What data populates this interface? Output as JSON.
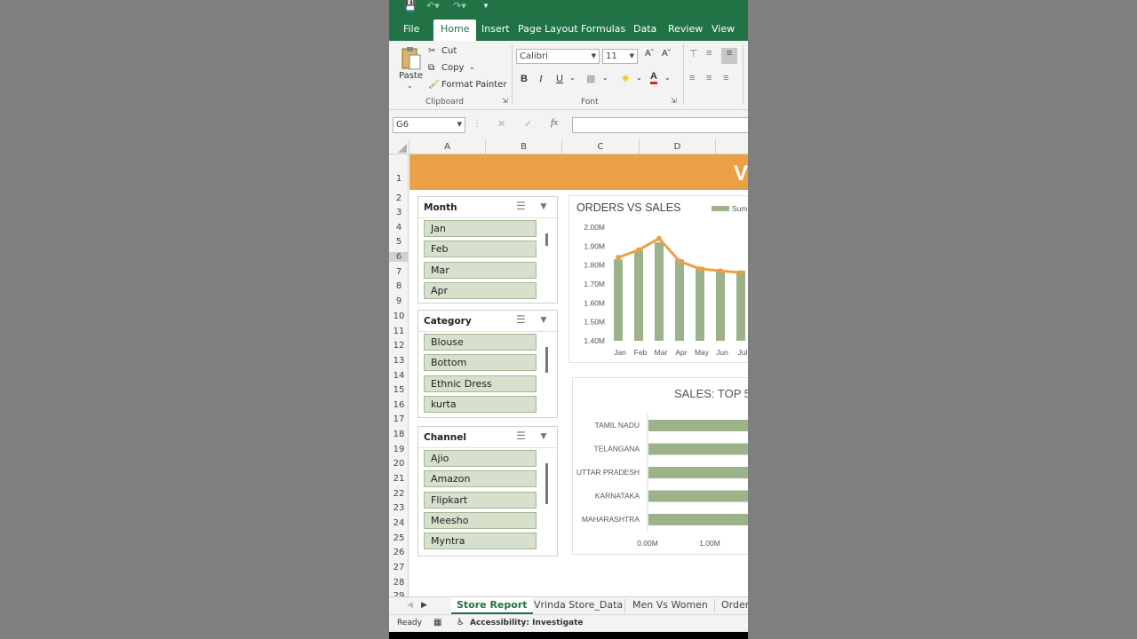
{
  "ribbon_tabs": [
    "File",
    "Home",
    "Insert",
    "Page Layout",
    "Formulas",
    "Data",
    "Review",
    "View"
  ],
  "clipboard": {
    "paste": "Paste",
    "cut": "Cut",
    "copy": "Copy",
    "format_painter": "Format Painter",
    "group": "Clipboard"
  },
  "font": {
    "name": "Calibri",
    "size": "11",
    "group": "Font",
    "bold": "B",
    "italic": "I",
    "underline": "U"
  },
  "formula_bar": {
    "name_box": "G6",
    "fx": "fx",
    "value": ""
  },
  "columns": [
    "A",
    "B",
    "C",
    "D"
  ],
  "rows": [
    "1",
    "2",
    "3",
    "4",
    "5",
    "6",
    "7",
    "8",
    "9",
    "10",
    "11",
    "12",
    "13",
    "14",
    "15",
    "16",
    "17",
    "18",
    "19",
    "20",
    "21",
    "22",
    "23",
    "24",
    "25",
    "26",
    "27",
    "28",
    "29"
  ],
  "banner_text": "V",
  "slicers": {
    "month": {
      "title": "Month",
      "items": [
        "Jan",
        "Feb",
        "Mar",
        "Apr"
      ]
    },
    "category": {
      "title": "Category",
      "items": [
        "Blouse",
        "Bottom",
        "Ethnic Dress",
        "kurta"
      ]
    },
    "channel": {
      "title": "Channel",
      "items": [
        "Ajio",
        "Amazon",
        "Flipkart",
        "Meesho",
        "Myntra"
      ]
    }
  },
  "chart_data": [
    {
      "type": "bar",
      "title": "ORDERS VS SALES",
      "legend": "Sum",
      "legend_position": "top-right",
      "categories": [
        "Jan",
        "Feb",
        "Mar",
        "Apr",
        "May",
        "Jun",
        "Jul"
      ],
      "series": [
        {
          "name": "Sum",
          "type": "bar",
          "values": [
            1.83,
            1.88,
            1.92,
            1.83,
            1.79,
            1.77,
            1.77
          ]
        },
        {
          "type": "line",
          "values": [
            1.84,
            1.88,
            1.94,
            1.82,
            1.78,
            1.77,
            1.76
          ]
        }
      ],
      "y_ticks": [
        "2.00M",
        "1.90M",
        "1.80M",
        "1.70M",
        "1.60M",
        "1.50M",
        "1.40M"
      ],
      "ylim": [
        1.4,
        2.0
      ],
      "colors": {
        "bar": "#9cb38a",
        "line": "#eba045"
      }
    },
    {
      "type": "bar",
      "orientation": "horizontal",
      "title": "SALES: TOP 5",
      "categories": [
        "TAMIL NADU",
        "TELANGANA",
        "UTTAR PRADESH",
        "KARNATAKA",
        "MAHARASHTRA"
      ],
      "x_ticks": [
        "0.00M",
        "1.00M"
      ],
      "colors": {
        "bar": "#9cb38a"
      }
    }
  ],
  "sheet_tabs": [
    "Store Report",
    "Vrinda Store_Data",
    "Men Vs Women",
    "Order"
  ],
  "status": {
    "ready": "Ready",
    "accessibility": "Accessibility: Investigate"
  }
}
